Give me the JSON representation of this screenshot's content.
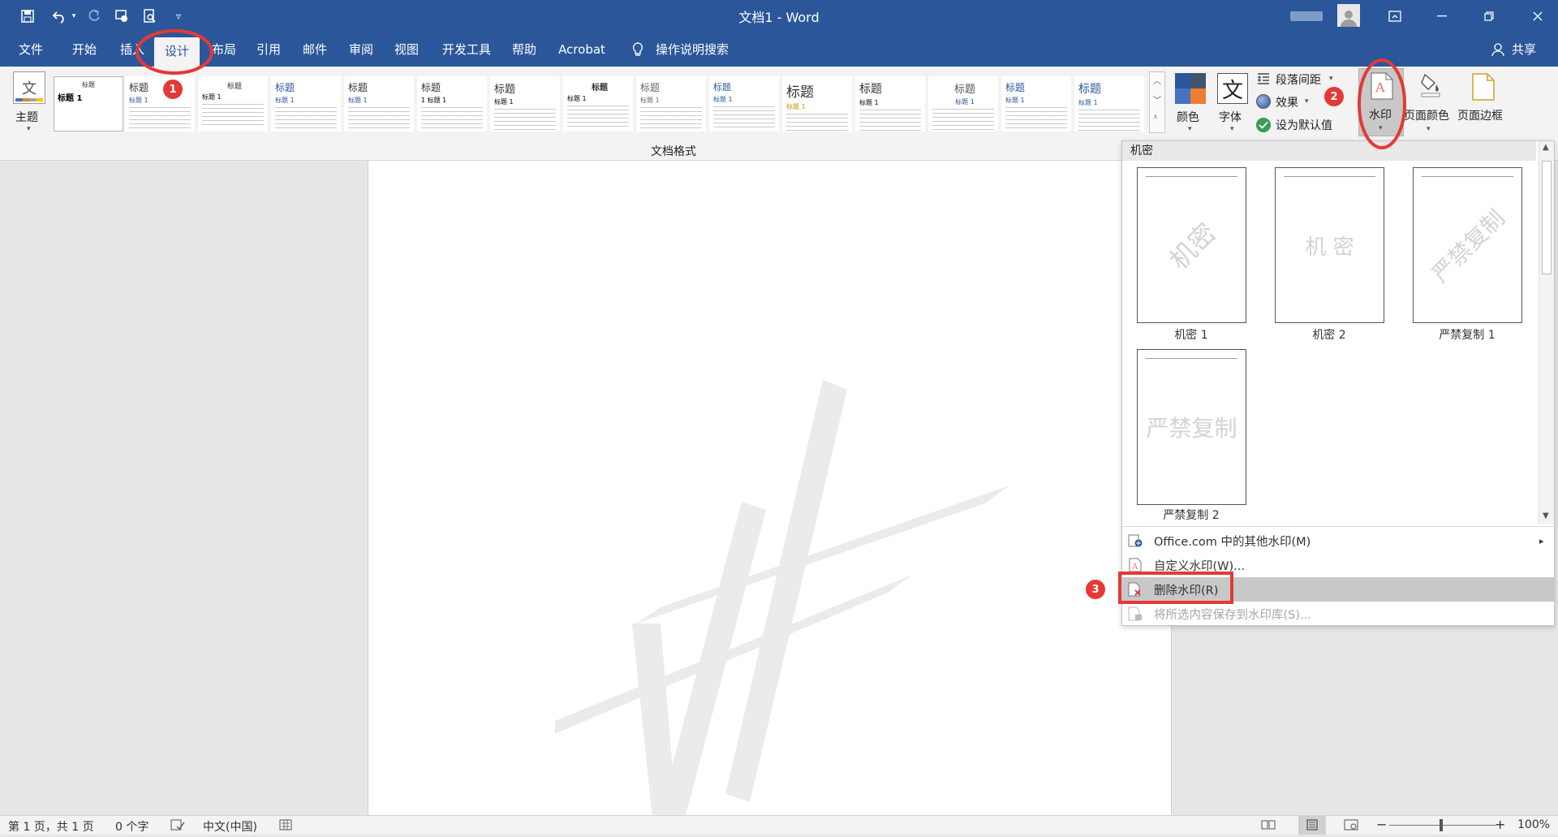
{
  "title": "文档1  -  Word",
  "tabs": [
    "文件",
    "开始",
    "插入",
    "设计",
    "布局",
    "引用",
    "邮件",
    "审阅",
    "视图",
    "开发工具",
    "帮助",
    "Acrobat"
  ],
  "tell_me": "操作说明搜索",
  "share": "共享",
  "ribbon": {
    "theme_label": "主题",
    "group_label": "文档格式",
    "styles": [
      {
        "t1": "标题",
        "t2": "标题 1"
      },
      {
        "t1": "标题",
        "t2": "标题 1"
      },
      {
        "t1": "标题",
        "t2": "标题 1"
      },
      {
        "t1": "标题",
        "t2": "标题 1"
      },
      {
        "t1": "标题",
        "t2": "标题 1"
      },
      {
        "t1": "标题",
        "t2": "1 标题 1"
      },
      {
        "t1": "标题",
        "t2": "标题 1"
      },
      {
        "t1": "标题",
        "t2": "标题 1"
      },
      {
        "t1": "标题",
        "t2": "标题 1"
      },
      {
        "t1": "标题",
        "t2": "标题 1"
      },
      {
        "t1": "标题",
        "t2": "标题 1"
      },
      {
        "t1": "标题",
        "t2": "标题 1"
      },
      {
        "t1": "标题",
        "t2": "标题 1"
      },
      {
        "t1": "标题",
        "t2": "标题 1"
      },
      {
        "t1": "标题",
        "t2": "标题 1"
      }
    ],
    "first_style": {
      "t1": "标题",
      "t2": "标题 1"
    },
    "colors_label": "颜色",
    "fonts_label": "字体",
    "font_glyph": "文",
    "para_spacing_label": "段落间距",
    "effects_label": "效果",
    "set_default_label": "设为默认值",
    "watermark_label": "水印",
    "page_color_label": "页面颜色",
    "page_border_label": "页面边框"
  },
  "watermark_menu": {
    "section_header": "机密",
    "items": [
      {
        "caption": "机密 1",
        "text": "机密"
      },
      {
        "caption": "机密 2",
        "text": "机 密"
      },
      {
        "caption": "严禁复制 1",
        "text": "严禁复制"
      },
      {
        "caption": "严禁复制 2",
        "text": "严禁复制"
      }
    ],
    "more_online": "Office.com 中的其他水印(M)",
    "custom": "自定义水印(W)...",
    "remove": "删除水印(R)",
    "save_selection": "将所选内容保存到水印库(S)..."
  },
  "status": {
    "page": "第 1 页，共 1 页",
    "words": "0 个字",
    "language": "中文(中国)",
    "zoom": "100%"
  },
  "annotations": [
    "1",
    "2",
    "3"
  ],
  "colors": {
    "brand": "#2b579a",
    "annotation": "#e53935",
    "highlight": "#c8c8c8"
  }
}
